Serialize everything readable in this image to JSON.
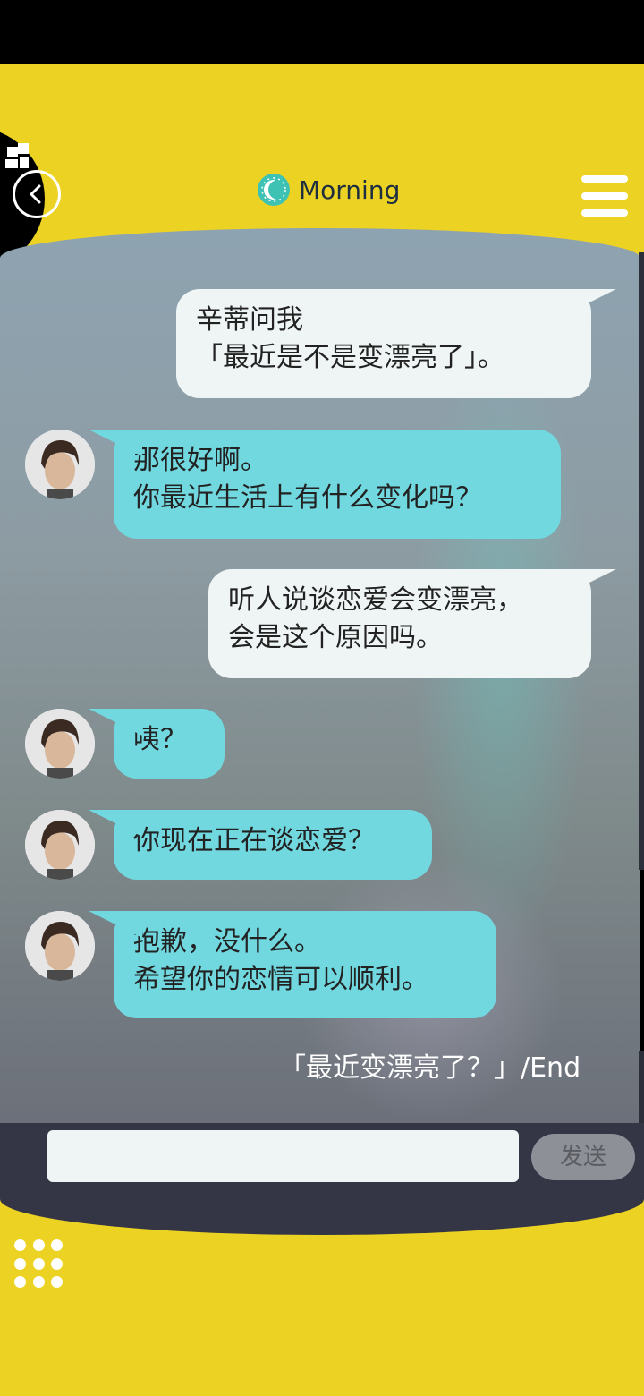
{
  "header": {
    "title": "Morning",
    "time_icon": "moon-sun-icon",
    "back_icon": "back-arrow-icon",
    "menu_icon": "hamburger-menu-icon"
  },
  "messages": [
    {
      "sender": "me",
      "lines": [
        "辛蒂问我",
        "「最近是不是变漂亮了」。"
      ]
    },
    {
      "sender": "npc",
      "lines": [
        "那很好啊。",
        "你最近生活上有什么变化吗？"
      ]
    },
    {
      "sender": "me",
      "lines": [
        "听人说谈恋爱会变漂亮，",
        "会是这个原因吗。"
      ]
    },
    {
      "sender": "npc",
      "lines": [
        "咦？"
      ]
    },
    {
      "sender": "npc",
      "lines": [
        "你现在正在谈恋爱？"
      ]
    },
    {
      "sender": "npc",
      "lines": [
        "抱歉，没什么。",
        "希望你的恋情可以顺利。"
      ]
    }
  ],
  "end_text": "「最近变漂亮了？」/End",
  "input": {
    "placeholder": "",
    "value": ""
  },
  "send_label": "发送",
  "colors": {
    "yellow": "#ecd323",
    "npc_bubble": "#72d8e0",
    "me_bubble": "#eef5f4",
    "input_bar": "#343646"
  }
}
